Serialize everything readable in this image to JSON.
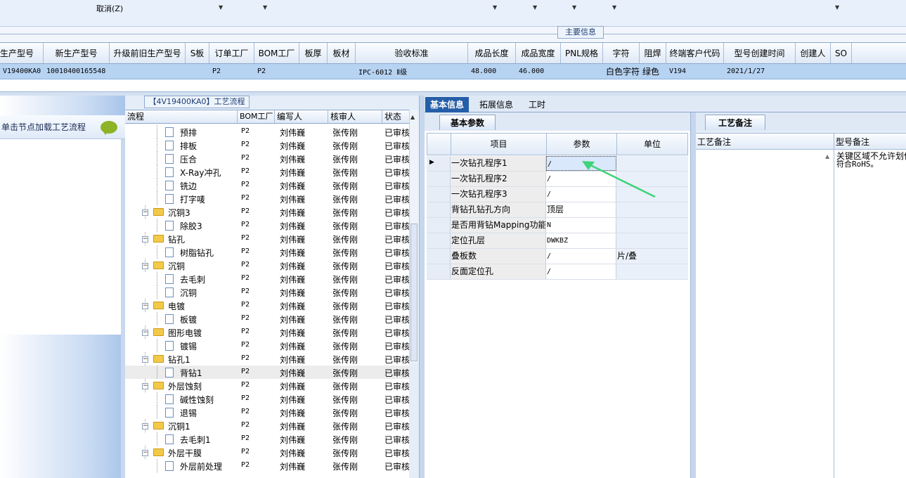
{
  "toolbar": {
    "cancel_label": "取消(Z)"
  },
  "group_header": "主要信息",
  "grid": {
    "columns": [
      "生产型号",
      "新生产型号",
      "升级前旧生产型号",
      "S板",
      "订单工厂",
      "BOM工厂",
      "板厚",
      "板材",
      "验收标准",
      "成品长度",
      "成品宽度",
      "PNL规格",
      "字符",
      "阻焊",
      "终端客户代码",
      "型号创建时间",
      "创建人",
      "SO"
    ],
    "row": [
      "V19400KA0",
      "10010400165548",
      "",
      "",
      "P2",
      "P2",
      "",
      "",
      "IPC-6012 Ⅱ级",
      "48.000",
      "46.000",
      "",
      "白色字符",
      "绿色",
      "V194",
      "2021/1/27",
      "",
      ""
    ]
  },
  "left_panel": {
    "hint": "单击节点加载工艺流程"
  },
  "tree": {
    "title": "【4V19400KA0】工艺流程",
    "columns": [
      "流程",
      "BOM工厂",
      "编写人",
      "核审人",
      "状态"
    ],
    "rows": [
      {
        "name": "预排",
        "level": 2,
        "folder": false,
        "bom": "P2",
        "writer": "刘伟巍",
        "reviewer": "张传刚",
        "status": "已审核"
      },
      {
        "name": "排板",
        "level": 2,
        "folder": false,
        "bom": "P2",
        "writer": "刘伟巍",
        "reviewer": "张传刚",
        "status": "已审核"
      },
      {
        "name": "压合",
        "level": 2,
        "folder": false,
        "bom": "P2",
        "writer": "刘伟巍",
        "reviewer": "张传刚",
        "status": "已审核"
      },
      {
        "name": "X-Ray冲孔",
        "level": 2,
        "folder": false,
        "bom": "P2",
        "writer": "刘伟巍",
        "reviewer": "张传刚",
        "status": "已审核"
      },
      {
        "name": "铣边",
        "level": 2,
        "folder": false,
        "bom": "P2",
        "writer": "刘伟巍",
        "reviewer": "张传刚",
        "status": "已审核"
      },
      {
        "name": "打字唛",
        "level": 2,
        "folder": false,
        "bom": "P2",
        "writer": "刘伟巍",
        "reviewer": "张传刚",
        "status": "已审核"
      },
      {
        "name": "沉铜3",
        "level": 1,
        "folder": true,
        "bom": "P2",
        "writer": "刘伟巍",
        "reviewer": "张传刚",
        "status": "已审核"
      },
      {
        "name": "除胶3",
        "level": 2,
        "folder": false,
        "bom": "P2",
        "writer": "刘伟巍",
        "reviewer": "张传刚",
        "status": "已审核"
      },
      {
        "name": "钻孔",
        "level": 1,
        "folder": true,
        "bom": "P2",
        "writer": "刘伟巍",
        "reviewer": "张传刚",
        "status": "已审核"
      },
      {
        "name": "树脂钻孔",
        "level": 2,
        "folder": false,
        "bom": "P2",
        "writer": "刘伟巍",
        "reviewer": "张传刚",
        "status": "已审核"
      },
      {
        "name": "沉铜",
        "level": 1,
        "folder": true,
        "bom": "P2",
        "writer": "刘伟巍",
        "reviewer": "张传刚",
        "status": "已审核"
      },
      {
        "name": "去毛刺",
        "level": 2,
        "folder": false,
        "bom": "P2",
        "writer": "刘伟巍",
        "reviewer": "张传刚",
        "status": "已审核"
      },
      {
        "name": "沉铜",
        "level": 2,
        "folder": false,
        "bom": "P2",
        "writer": "刘伟巍",
        "reviewer": "张传刚",
        "status": "已审核"
      },
      {
        "name": "电镀",
        "level": 1,
        "folder": true,
        "bom": "P2",
        "writer": "刘伟巍",
        "reviewer": "张传刚",
        "status": "已审核"
      },
      {
        "name": "板镀",
        "level": 2,
        "folder": false,
        "bom": "P2",
        "writer": "刘伟巍",
        "reviewer": "张传刚",
        "status": "已审核"
      },
      {
        "name": "图形电镀",
        "level": 1,
        "folder": true,
        "bom": "P2",
        "writer": "刘伟巍",
        "reviewer": "张传刚",
        "status": "已审核"
      },
      {
        "name": "镀锡",
        "level": 2,
        "folder": false,
        "bom": "P2",
        "writer": "刘伟巍",
        "reviewer": "张传刚",
        "status": "已审核"
      },
      {
        "name": "钻孔1",
        "level": 1,
        "folder": true,
        "bom": "P2",
        "writer": "刘伟巍",
        "reviewer": "张传刚",
        "status": "已审核"
      },
      {
        "name": "背钻1",
        "level": 2,
        "folder": false,
        "bom": "P2",
        "writer": "刘伟巍",
        "reviewer": "张传刚",
        "status": "已审核",
        "selected": true
      },
      {
        "name": "外层蚀刻",
        "level": 1,
        "folder": true,
        "bom": "P2",
        "writer": "刘伟巍",
        "reviewer": "张传刚",
        "status": "已审核"
      },
      {
        "name": "碱性蚀刻",
        "level": 2,
        "folder": false,
        "bom": "P2",
        "writer": "刘伟巍",
        "reviewer": "张传刚",
        "status": "已审核"
      },
      {
        "name": "退锡",
        "level": 2,
        "folder": false,
        "bom": "P2",
        "writer": "刘伟巍",
        "reviewer": "张传刚",
        "status": "已审核"
      },
      {
        "name": "沉铜1",
        "level": 1,
        "folder": true,
        "bom": "P2",
        "writer": "刘伟巍",
        "reviewer": "张传刚",
        "status": "已审核"
      },
      {
        "name": "去毛刺1",
        "level": 2,
        "folder": false,
        "bom": "P2",
        "writer": "刘伟巍",
        "reviewer": "张传刚",
        "status": "已审核"
      },
      {
        "name": "外层干膜",
        "level": 1,
        "folder": true,
        "bom": "P2",
        "writer": "刘伟巍",
        "reviewer": "张传刚",
        "status": "已审核"
      },
      {
        "name": "外层前处理",
        "level": 2,
        "folder": false,
        "bom": "P2",
        "writer": "刘伟巍",
        "reviewer": "张传刚",
        "status": "已审核"
      }
    ]
  },
  "tabs": [
    "基本信息",
    "拓展信息",
    "工时"
  ],
  "param_panel": {
    "tab": "基本参数",
    "columns": [
      "项目",
      "参数",
      "单位"
    ],
    "rows": [
      {
        "item": "一次钻孔程序1",
        "value": "/",
        "unit": ""
      },
      {
        "item": "一次钻孔程序2",
        "value": "/",
        "unit": ""
      },
      {
        "item": "一次钻孔程序3",
        "value": "/",
        "unit": ""
      },
      {
        "item": "背钻孔钻孔方向",
        "value": "顶层",
        "unit": ""
      },
      {
        "item": "是否用背钻Mapping功能",
        "value": "N",
        "unit": ""
      },
      {
        "item": "定位孔层",
        "value": "DWKBZ",
        "unit": ""
      },
      {
        "item": "叠板数",
        "value": "/",
        "unit": "片/叠"
      },
      {
        "item": "反面定位孔",
        "value": "/",
        "unit": ""
      }
    ]
  },
  "notes_panel": {
    "tab": "工艺备注",
    "columns": [
      "工艺备注",
      "型号备注"
    ],
    "model_note_lines": [
      "关键区域不允许划伤",
      "符合RoHS。"
    ]
  },
  "colors": {
    "accent": "#255ea8",
    "selection": "#b7d3f2",
    "arrow": "#3fd37a"
  }
}
